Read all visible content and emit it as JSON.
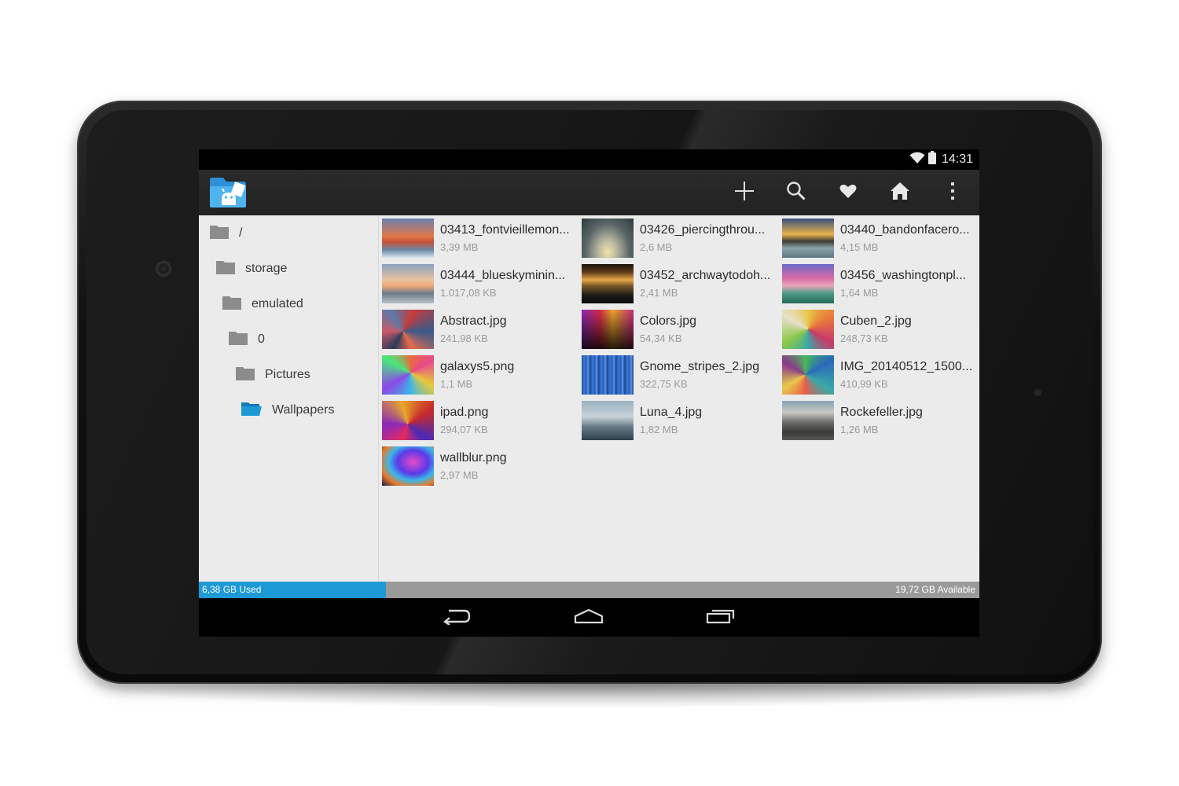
{
  "status_bar": {
    "time": "14:31",
    "icons": [
      "wifi-icon",
      "battery-icon"
    ]
  },
  "action_bar": {
    "app_icon": "file-manager-app-icon",
    "actions": [
      "add-icon",
      "search-icon",
      "favorite-heart-icon",
      "home-icon",
      "overflow-menu-icon"
    ]
  },
  "tree": {
    "items": [
      {
        "label": "/",
        "icon": "folder-icon",
        "active": false
      },
      {
        "label": "storage",
        "icon": "folder-icon",
        "active": false
      },
      {
        "label": "emulated",
        "icon": "folder-icon",
        "active": false
      },
      {
        "label": "0",
        "icon": "folder-icon",
        "active": false
      },
      {
        "label": "Pictures",
        "icon": "folder-icon",
        "active": false
      },
      {
        "label": "Wallpapers",
        "icon": "folder-open-icon",
        "active": true
      }
    ]
  },
  "files": [
    {
      "name": "03413_fontvieillemon...",
      "size": "3,39 MB"
    },
    {
      "name": "03426_piercingthrou...",
      "size": "2,6 MB"
    },
    {
      "name": "03440_bandonfacero...",
      "size": "4,15 MB"
    },
    {
      "name": "03444_blueskyminin...",
      "size": "1.017,08 KB"
    },
    {
      "name": "03452_archwaytodoh...",
      "size": "2,41 MB"
    },
    {
      "name": "03456_washingtonpl...",
      "size": "1,64 MB"
    },
    {
      "name": "Abstract.jpg",
      "size": "241,98 KB"
    },
    {
      "name": "Colors.jpg",
      "size": "54,34 KB"
    },
    {
      "name": "Cuben_2.jpg",
      "size": "248,73 KB"
    },
    {
      "name": "galaxys5.png",
      "size": "1,1 MB"
    },
    {
      "name": "Gnome_stripes_2.jpg",
      "size": "322,75 KB"
    },
    {
      "name": "IMG_20140512_1500...",
      "size": "410,99 KB"
    },
    {
      "name": "ipad.png",
      "size": "294,07 KB"
    },
    {
      "name": "Luna_4.jpg",
      "size": "1,82 MB"
    },
    {
      "name": "Rockefeller.jpg",
      "size": "1,26 MB"
    },
    {
      "name": "wallblur.png",
      "size": "2,97 MB"
    }
  ],
  "storage": {
    "used_label": "6,38 GB Used",
    "available_label": "19,72 GB Available",
    "used_fraction": 0.24,
    "used_color": "#1d9ad6"
  },
  "nav_bar": {
    "buttons": [
      "back-icon",
      "home-icon",
      "recents-icon"
    ]
  },
  "colors": {
    "accent": "#1d9ad6",
    "folder_gray": "#8c8c8c",
    "folder_blue": "#1d9ad6"
  }
}
